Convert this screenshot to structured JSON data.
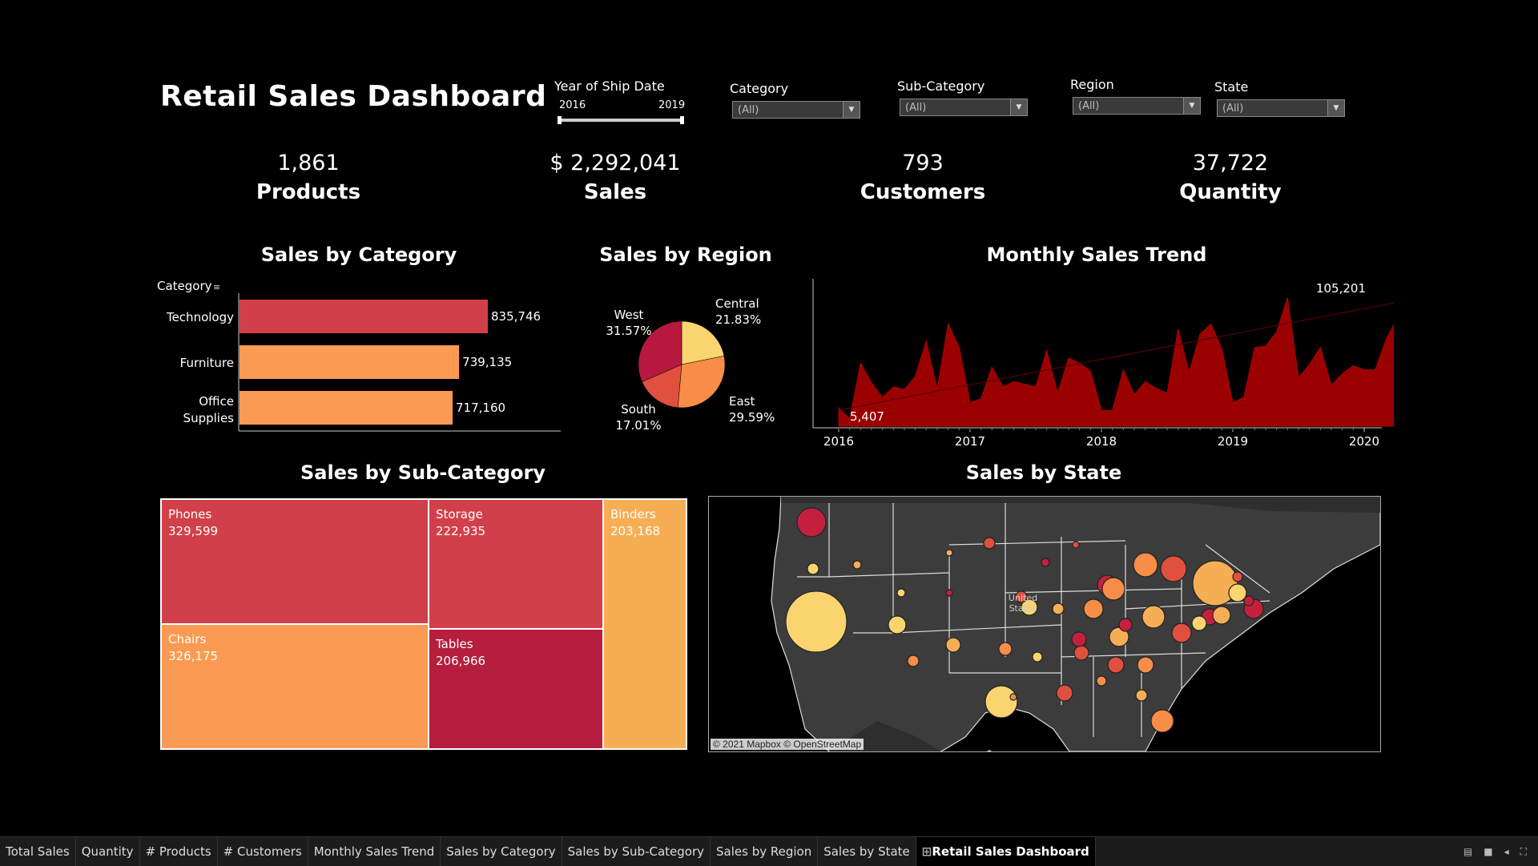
{
  "title": "Retail Sales Dashboard",
  "filters": {
    "year": {
      "label": "Year of Ship Date",
      "start": "2016",
      "end": "2019",
      "range_min": 2016,
      "range_max": 2019,
      "selected_start": 2016,
      "selected_end": 2019
    },
    "category": {
      "label": "Category",
      "value": "(All)"
    },
    "subcategory": {
      "label": "Sub-Category",
      "value": "(All)"
    },
    "region": {
      "label": "Region",
      "value": "(All)"
    },
    "state": {
      "label": "State",
      "value": "(All)"
    }
  },
  "kpis": {
    "products": {
      "value": "1,861",
      "label": "Products"
    },
    "sales": {
      "value": "$ 2,292,041",
      "label": "Sales"
    },
    "customers": {
      "value": "793",
      "label": "Customers"
    },
    "quantity": {
      "value": "37,722",
      "label": "Quantity"
    }
  },
  "sections": {
    "category": "Sales by Category",
    "region": "Sales by Region",
    "trend": "Monthly Sales Trend",
    "subcategory": "Sales by Sub-Category",
    "state": "Sales by State"
  },
  "chart_data": [
    {
      "type": "bar",
      "title": "Sales by Category",
      "header": "Category",
      "categories": [
        "Technology",
        "Furniture",
        "Office Supplies"
      ],
      "values": [
        835746,
        739135,
        717160
      ],
      "labels": [
        "835,746",
        "739,135",
        "717,160"
      ],
      "colors": [
        "#d1404a",
        "#fb9a52",
        "#fb9a52"
      ]
    },
    {
      "type": "pie",
      "title": "Sales by Region",
      "slices": [
        {
          "name": "Central",
          "pct": 21.83,
          "label": "21.83%",
          "color": "#f9d46f"
        },
        {
          "name": "East",
          "pct": 29.59,
          "label": "29.59%",
          "color": "#f78d46"
        },
        {
          "name": "South",
          "pct": 17.01,
          "label": "17.01%",
          "color": "#e0503f"
        },
        {
          "name": "West",
          "pct": 31.57,
          "label": "31.57%",
          "color": "#b8183e"
        }
      ]
    },
    {
      "type": "area",
      "title": "Monthly Sales Trend",
      "x_ticks": [
        "2016",
        "2017",
        "2018",
        "2019",
        "2020"
      ],
      "min_label": "5,407",
      "max_label": "105,201",
      "values": [
        14000,
        5407,
        48000,
        33000,
        22000,
        30000,
        28000,
        38000,
        65000,
        28000,
        78000,
        60000,
        18000,
        21000,
        45000,
        30000,
        34000,
        32000,
        30000,
        58000,
        25000,
        52000,
        48000,
        42000,
        12000,
        12000,
        43000,
        24000,
        34000,
        29000,
        25000,
        74000,
        41000,
        70000,
        78000,
        59000,
        18000,
        22000,
        60000,
        61000,
        72000,
        98000,
        37000,
        47000,
        60000,
        31000,
        40000,
        46000,
        43000,
        43000,
        66000,
        82000,
        94000,
        105201
      ],
      "color": "#9a0000"
    },
    {
      "type": "table",
      "title": "Sales by Sub-Category",
      "cells": [
        {
          "name": "Phones",
          "value": "329,599",
          "color": "#d1404a"
        },
        {
          "name": "Chairs",
          "value": "326,175",
          "color": "#fb9a52"
        },
        {
          "name": "Storage",
          "value": "222,935",
          "color": "#d1404a"
        },
        {
          "name": "Tables",
          "value": "206,966",
          "color": "#b51e3e"
        },
        {
          "name": "Binders",
          "value": "203,168",
          "color": "#f6ae55"
        }
      ]
    }
  ],
  "map": {
    "attribution": "© 2021 Mapbox © OpenStreetMap",
    "country_label": "United States",
    "bubble_values": [
      320,
      95,
      90,
      40,
      40,
      40,
      35,
      35,
      30,
      28,
      28,
      25,
      25,
      25,
      22,
      22,
      20,
      20,
      18,
      18,
      16,
      15,
      15,
      14,
      14,
      13,
      12,
      12,
      10,
      10,
      9,
      8,
      8,
      7,
      7,
      6,
      6,
      5,
      5,
      4,
      4,
      3,
      3,
      2,
      2,
      2
    ],
    "palette": [
      "#f9d46f",
      "#f6ae55",
      "#f78d46",
      "#e0503f",
      "#c4203e"
    ]
  },
  "tabs": [
    "Total Sales",
    "Quantity",
    "# Products",
    "# Customers",
    "Monthly Sales Trend",
    "Sales by Category",
    "Sales by Sub-Category",
    "Sales by Region",
    "Sales by State",
    "Retail Sales Dashboard"
  ],
  "active_tab": "Retail Sales Dashboard"
}
